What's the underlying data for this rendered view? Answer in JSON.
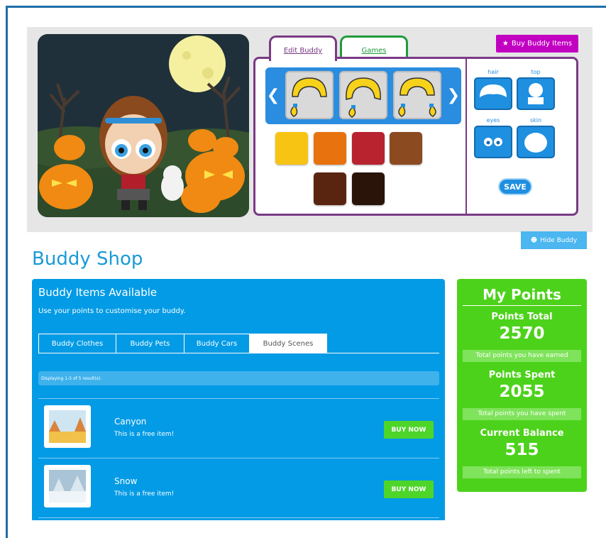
{
  "editor": {
    "tabs": {
      "edit_buddy": "Edit Buddy",
      "games": "Games"
    },
    "buy_button": "Buy Buddy Items",
    "categories": {
      "hair": "hair",
      "top": "top",
      "eyes": "eyes",
      "skin": "skin"
    },
    "save_label": "SAVE",
    "swatch_colors": [
      "#f7c414",
      "#e8730e",
      "#b8232f",
      "#8b4a1f",
      "#5a2510",
      "#2a140a"
    ]
  },
  "hide_buddy": "Hide Buddy",
  "shop": {
    "title": "Buddy Shop",
    "heading": "Buddy Items Available",
    "subheading": "Use your points to customise your buddy.",
    "tabs": [
      "Buddy Clothes",
      "Buddy Pets",
      "Buddy Cars",
      "Buddy Scenes"
    ],
    "active_tab": "Buddy Scenes",
    "results_text": "Displaying 1-5 of 5 result(s).",
    "items": [
      {
        "name": "Canyon",
        "desc": "This is a free item!",
        "button": "BUY NOW"
      },
      {
        "name": "Snow",
        "desc": "This is a free item!",
        "button": "BUY NOW"
      }
    ]
  },
  "points": {
    "title": "My Points",
    "total_label": "Points Total",
    "total_value": "2570",
    "total_note": "Total points you have earned",
    "spent_label": "Points Spent",
    "spent_value": "2055",
    "spent_note": "Total points you have spent",
    "balance_label": "Current Balance",
    "balance_value": "515",
    "balance_note": "Total points left to spent"
  },
  "colors": {
    "accent_blue": "#039be5",
    "points_green": "#4dd21b",
    "purple": "#7a3a85",
    "magenta": "#c200c2"
  }
}
